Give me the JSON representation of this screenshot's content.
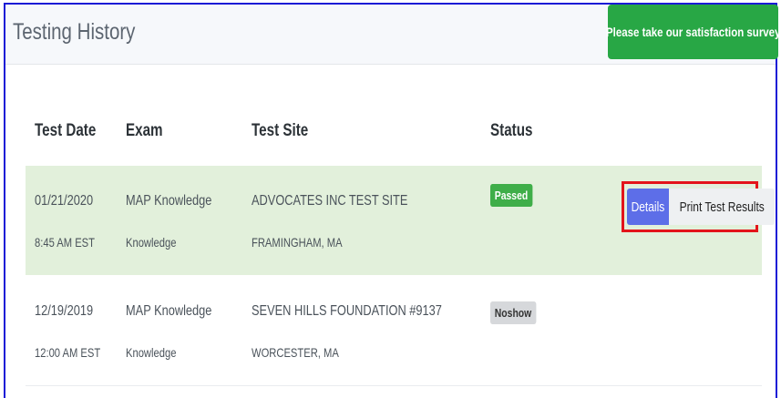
{
  "header": {
    "title": "Testing History",
    "survey_button": "Please take our satisfaction survey"
  },
  "table": {
    "columns": [
      "Test Date",
      "Exam",
      "Test Site",
      "Status"
    ],
    "rows": [
      {
        "date": "01/21/2020",
        "time": "8:45 AM EST",
        "exam": "MAP Knowledge",
        "exam_sub": "Knowledge",
        "site": "ADVOCATES INC TEST SITE",
        "location": "FRAMINGHAM, MA",
        "status": "Passed",
        "actions": {
          "details": "Details",
          "print": "Print Test Results"
        }
      },
      {
        "date": "12/19/2019",
        "time": "12:00 AM EST",
        "exam": "MAP Knowledge",
        "exam_sub": "Knowledge",
        "site": "SEVEN HILLS FOUNDATION #9137",
        "location": "WORCESTER, MA",
        "status": "Noshow"
      }
    ]
  },
  "colors": {
    "survey_button": "#28a745",
    "passed_row": "#e2f0db",
    "passed_badge": "#3fae49",
    "details_button": "#5d6ee8",
    "highlight_border": "#e3141b"
  }
}
